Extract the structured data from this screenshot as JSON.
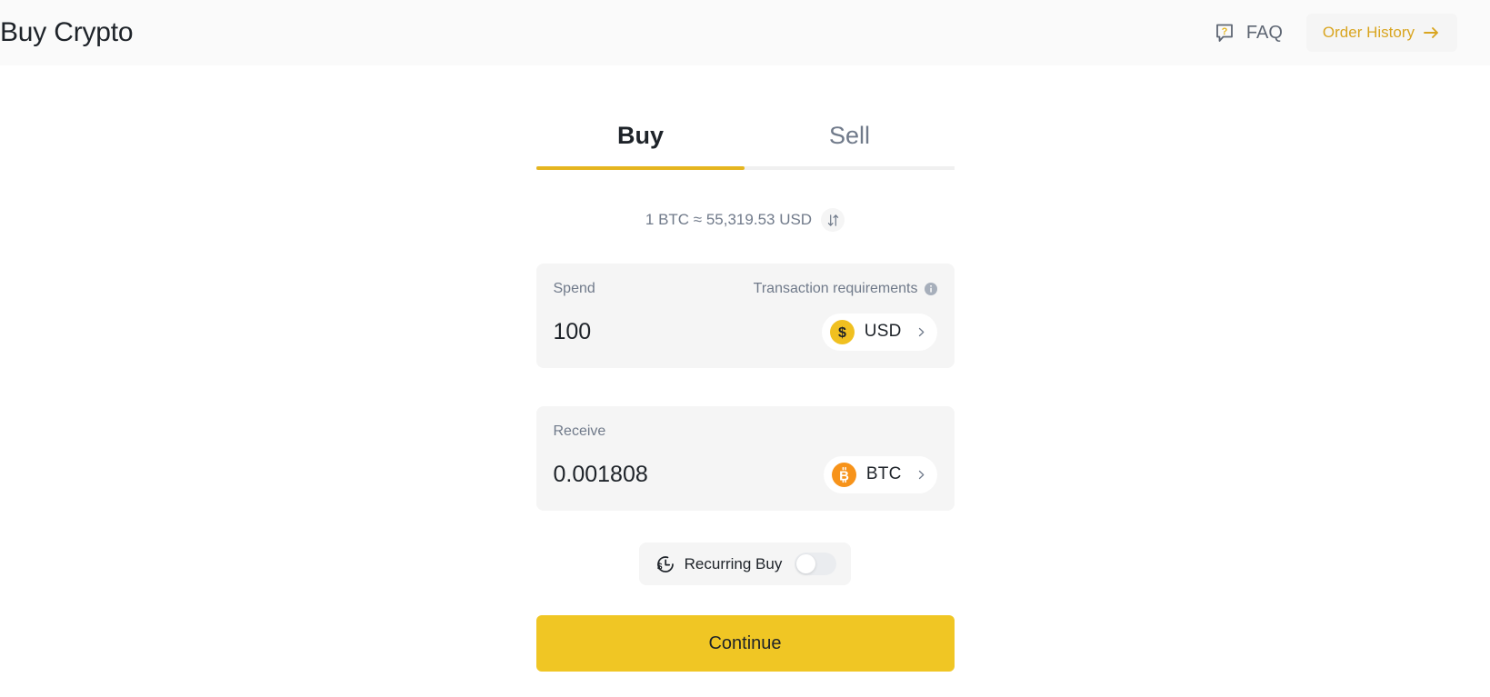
{
  "header": {
    "title": "Buy Crypto",
    "faq_label": "FAQ",
    "faq_icon": "question-speech-bubble-icon",
    "order_history_label": "Order History",
    "order_history_icon": "arrow-right-icon"
  },
  "tabs": [
    {
      "label": "Buy",
      "active": true
    },
    {
      "label": "Sell",
      "active": false
    }
  ],
  "rate": {
    "text": "1 BTC ≈ 55,319.53 USD",
    "swap_icon": "swap-vertical-icon"
  },
  "spend": {
    "label": "Spend",
    "requirements_label": "Transaction requirements",
    "info_icon": "info-circle-icon",
    "amount": "100",
    "placeholder": "0",
    "currency": "USD",
    "currency_icon": "usd-coin-icon",
    "chevron_icon": "chevron-right-icon"
  },
  "receive": {
    "label": "Receive",
    "amount": "0.001808",
    "placeholder": "0",
    "currency": "BTC",
    "currency_icon": "btc-coin-icon",
    "chevron_icon": "chevron-right-icon"
  },
  "recurring": {
    "label": "Recurring Buy",
    "icon": "recurring-dollar-clock-icon",
    "enabled": false
  },
  "continue": {
    "label": "Continue"
  },
  "colors": {
    "brand_gold": "#f0c624",
    "tab_indicator": "#e5b51f",
    "order_history_text": "#d9a520",
    "btc_orange": "#f7931a",
    "usd_yellow": "#f0c020",
    "panel_bg": "#f5f5f5",
    "header_bg": "#fafafa",
    "muted_text": "#707a8a",
    "primary_text": "#1e2329"
  }
}
